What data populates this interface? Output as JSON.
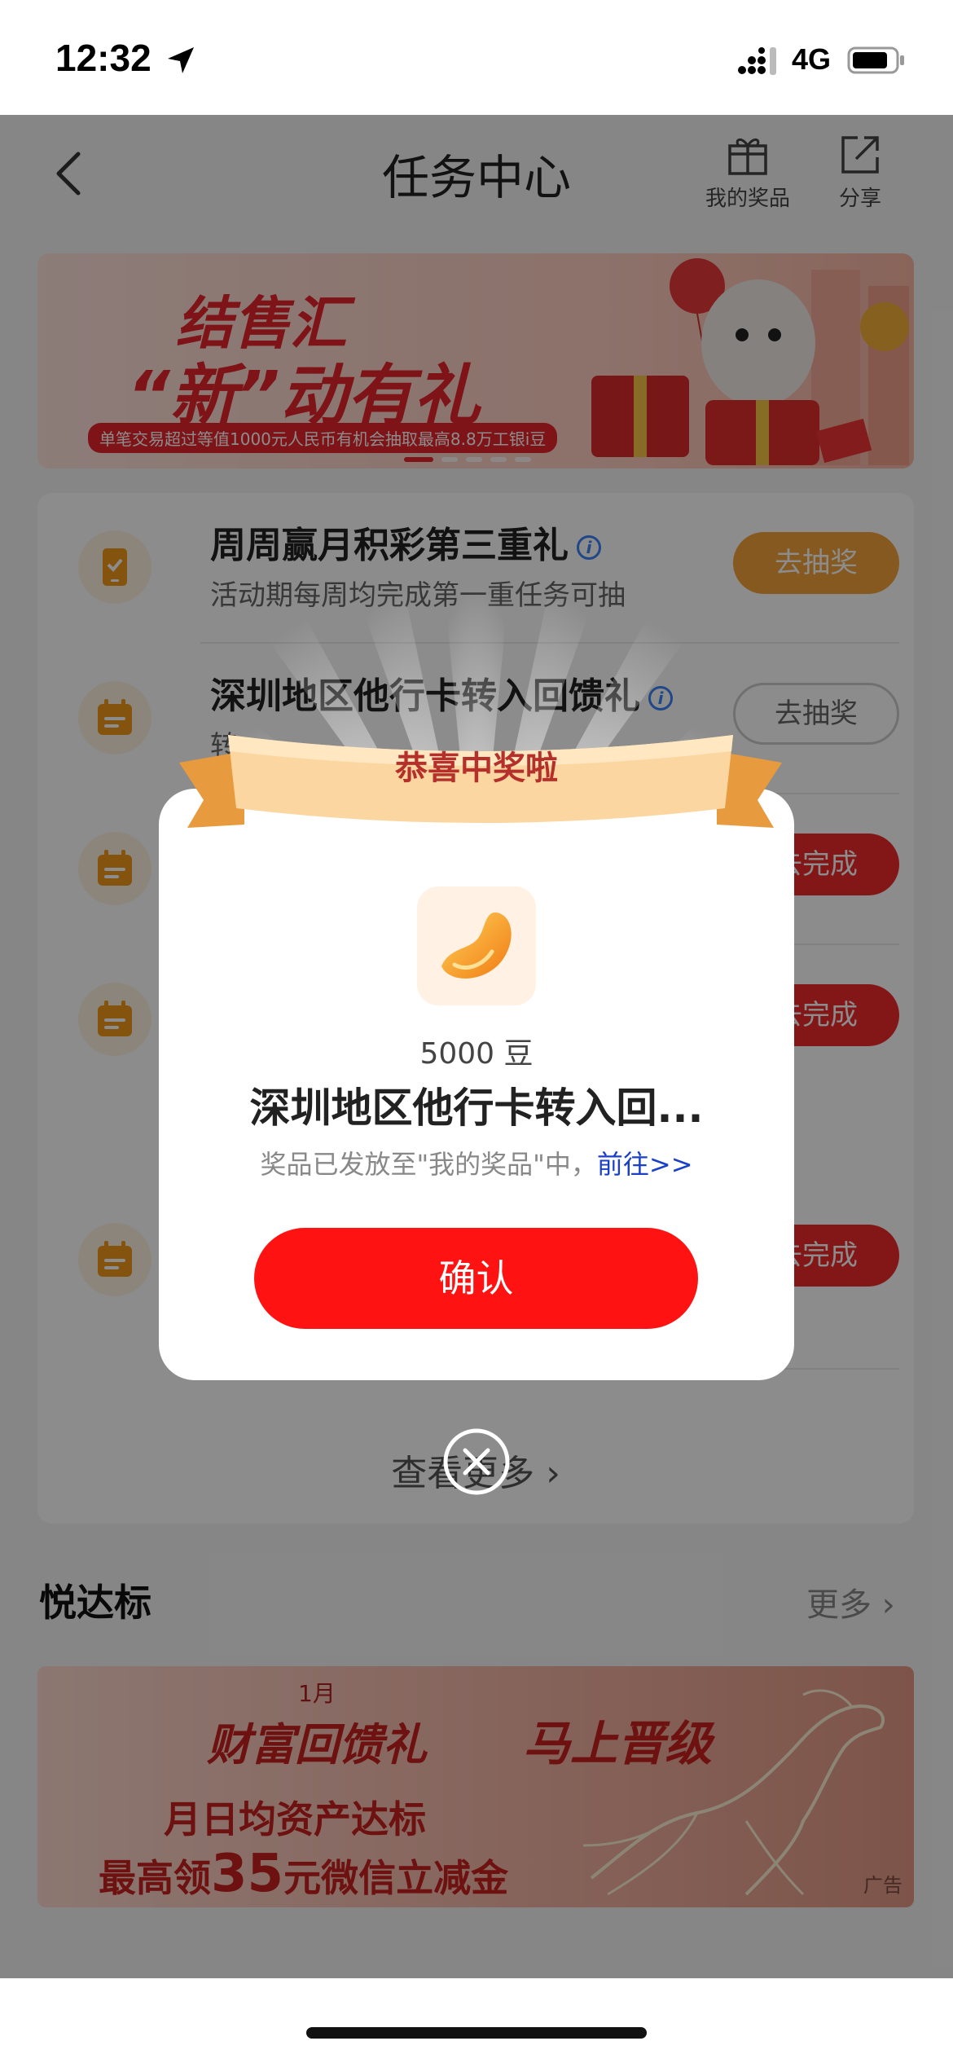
{
  "status_bar": {
    "time": "12:32",
    "network": "4G",
    "icons": [
      "location-arrow-icon",
      "signal-icon",
      "battery-icon"
    ]
  },
  "nav": {
    "title": "任务中心",
    "back_icon": "chevron-left-icon",
    "actions": [
      {
        "label": "我的奖品",
        "icon": "gift-icon"
      },
      {
        "label": "分享",
        "icon": "share-icon"
      }
    ]
  },
  "banner": {
    "line1": "结售汇",
    "line2": "“新”动有礼",
    "subtitle": "单笔交易超过等值1000元人民币有机会抽取最高8.8万工银i豆"
  },
  "tasks": [
    {
      "title": "周周赢月积彩第三重礼",
      "desc": "活动期每周均完成第一重任务可抽",
      "button": "去抽奖",
      "icon": "phone-check-icon"
    },
    {
      "title": "深圳地区他行卡转入回馈礼",
      "desc": "转",
      "button": "去抽奖",
      "icon": "calendar-icon"
    },
    {
      "title": "",
      "desc": "",
      "button": "去完成",
      "icon": "calendar-icon"
    },
    {
      "title": "",
      "desc": "",
      "button": "去完成",
      "icon": "calendar-icon"
    },
    {
      "title": "",
      "desc": "",
      "button": "去完成",
      "icon": "calendar-icon"
    }
  ],
  "see_more": "查看更多",
  "section": {
    "title": "悦达标",
    "more": "更多"
  },
  "ad": {
    "month": "1月",
    "title": "财富回馈礼",
    "upgrade": "马上晋级",
    "line1": "月日均资产达标",
    "line2_prefix": "最高领",
    "line2_amount": "35",
    "line2_suffix": "元微信立减金",
    "tag": "广告"
  },
  "modal": {
    "ribbon": "恭喜中奖啦",
    "prize_icon": "bean-icon",
    "amount": "5000 豆",
    "name": "深圳地区他行卡转入回...",
    "note": "奖品已发放至\"我的奖品\"中，",
    "link": "前往>>",
    "confirm": "确认",
    "close_icon": "close-circle-icon"
  },
  "colors": {
    "accent_red": "#ff1212",
    "orange_button": "#f3a33a",
    "link_blue": "#1a3fc8"
  }
}
